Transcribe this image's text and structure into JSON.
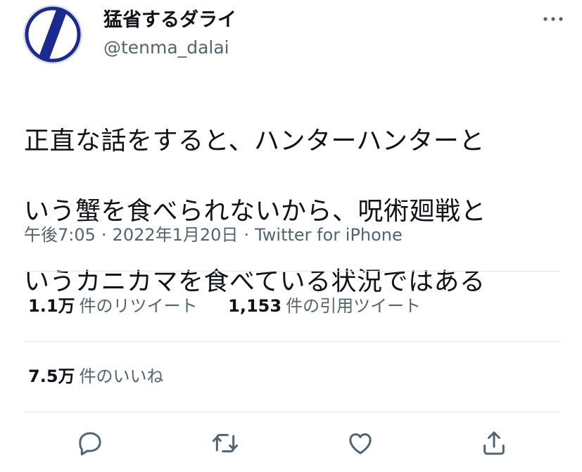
{
  "author": {
    "display_name": "猛省するダライ",
    "handle": "@tenma_dalai",
    "avatar_icon": "avatar-slash-logo"
  },
  "tweet": {
    "text_lines": [
      "正直な話をすると、ハンターハンターと",
      "いう蟹を食べられないから、呪術廻戦と",
      "いうカニカマを食べている状況ではある"
    ],
    "time": "午後7:05",
    "date": "2022年1月20日",
    "separator": "·",
    "source": "Twitter for iPhone"
  },
  "stats": {
    "retweets_count": "1.1万",
    "retweets_label": "件のリツイート",
    "quotes_count": "1,153",
    "quotes_label": "件の引用ツイート",
    "likes_count": "7.5万",
    "likes_label": "件のいいね"
  },
  "actions": [
    "reply-icon",
    "retweet-icon",
    "like-icon",
    "share-icon"
  ],
  "colors": {
    "text": "#0f1419",
    "secondary": "#536471",
    "divider": "#e6e9eb",
    "avatar_ring": "#1b2a8c",
    "avatar_slash": "#1b2a8c"
  }
}
